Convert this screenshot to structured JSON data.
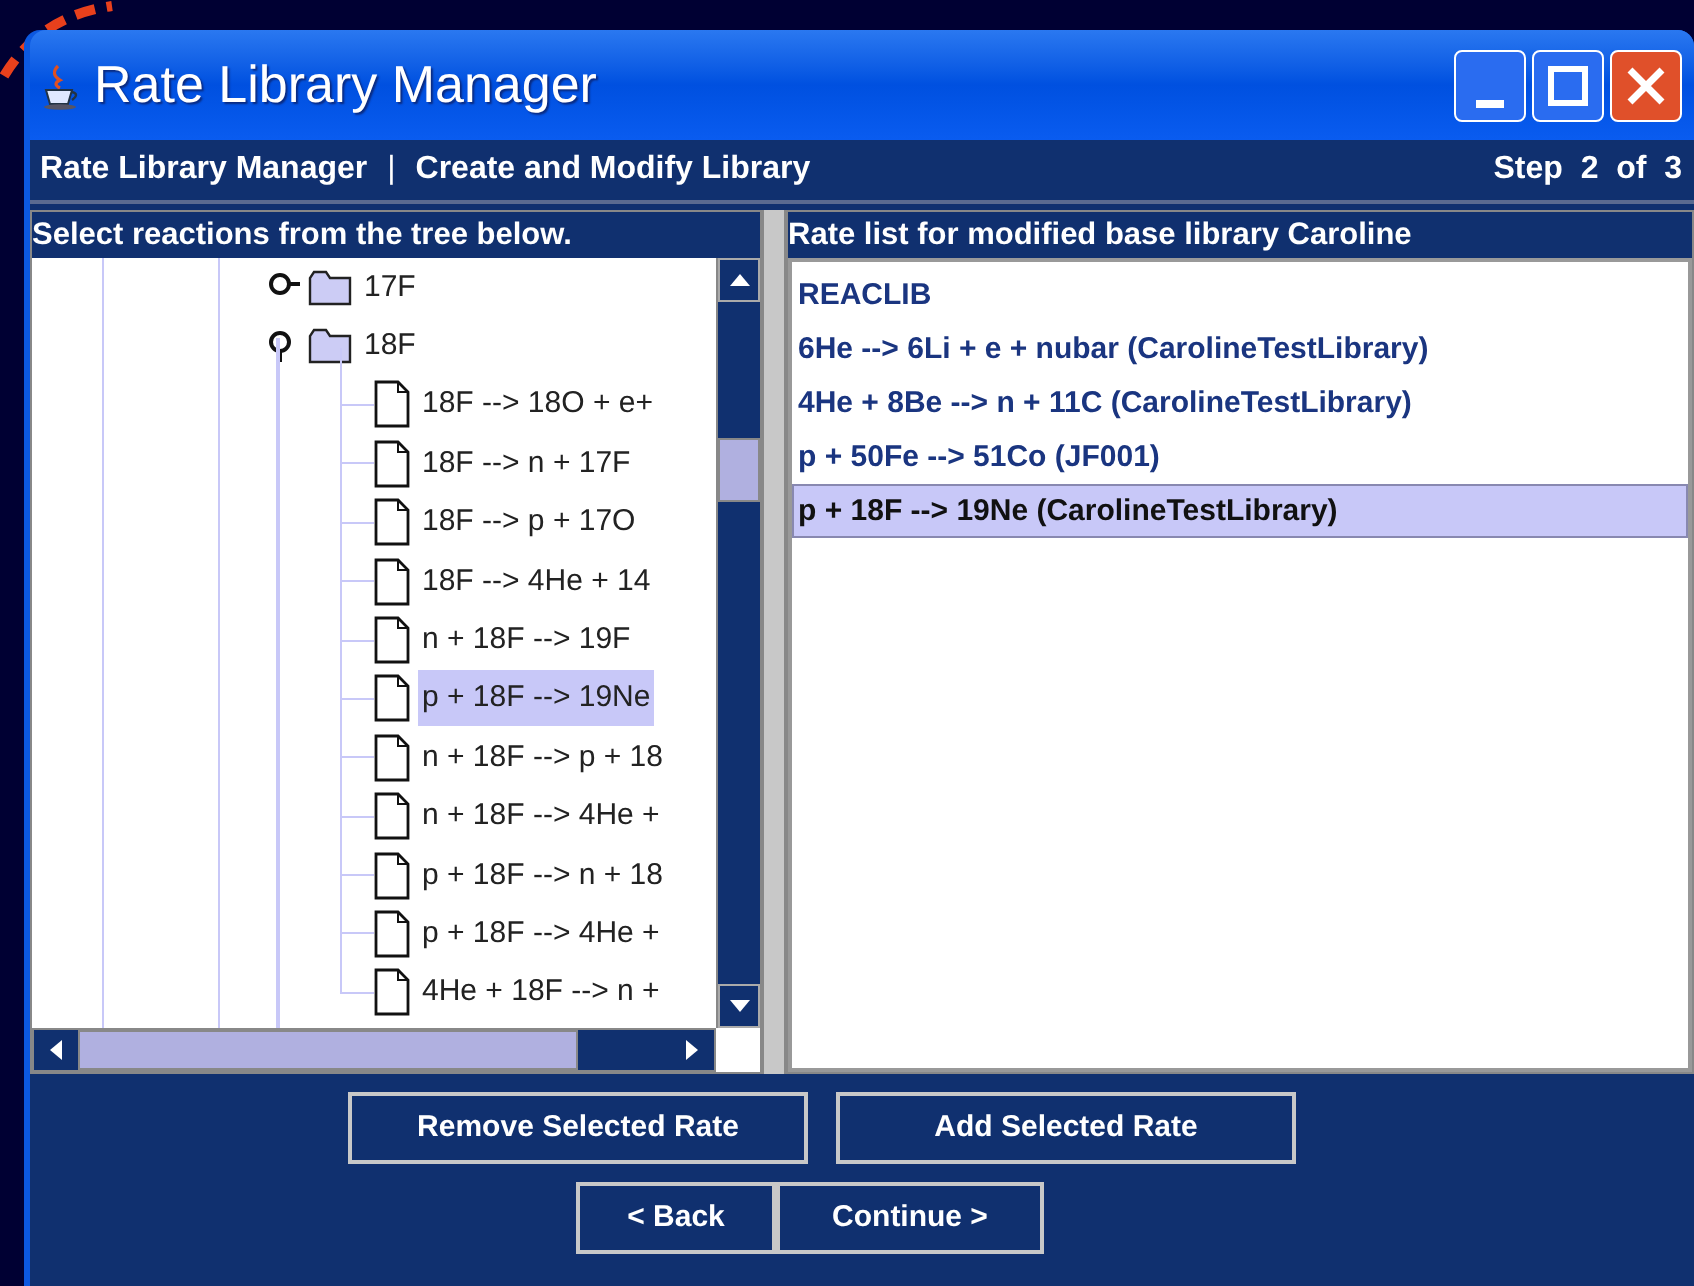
{
  "window": {
    "title": "Rate Library Manager"
  },
  "header": {
    "breadcrumb": [
      "Rate Library Manager",
      "Create and Modify Library"
    ],
    "separator": "|",
    "step": "Step  2  of  3"
  },
  "tree_panel": {
    "title": "Select reactions from the tree below.",
    "nodes": [
      {
        "label": "17F",
        "kind": "folder",
        "expanded": false,
        "selected": false
      },
      {
        "label": "18F",
        "kind": "folder",
        "expanded": true,
        "selected": false,
        "children": [
          {
            "label": "18F --> 18O + e+",
            "kind": "file",
            "selected": false
          },
          {
            "label": "18F --> n + 17F",
            "kind": "file",
            "selected": false
          },
          {
            "label": "18F --> p + 17O",
            "kind": "file",
            "selected": false
          },
          {
            "label": "18F --> 4He + 14",
            "kind": "file",
            "selected": false
          },
          {
            "label": "n + 18F --> 19F",
            "kind": "file",
            "selected": false
          },
          {
            "label": "p + 18F --> 19Ne",
            "kind": "file",
            "selected": true
          },
          {
            "label": "n + 18F --> p + 18",
            "kind": "file",
            "selected": false
          },
          {
            "label": "n + 18F --> 4He +",
            "kind": "file",
            "selected": false
          },
          {
            "label": "p + 18F --> n + 18",
            "kind": "file",
            "selected": false
          },
          {
            "label": "p + 18F --> 4He +",
            "kind": "file",
            "selected": false
          },
          {
            "label": "4He + 18F --> n +",
            "kind": "file",
            "selected": false
          }
        ]
      }
    ]
  },
  "rate_panel": {
    "title": "Rate list for modified base library Caroline",
    "items": [
      {
        "label": "REACLIB",
        "selected": false
      },
      {
        "label": "6He --> 6Li + e + nubar (CarolineTestLibrary)",
        "selected": false
      },
      {
        "label": "4He + 8Be --> n + 11C (CarolineTestLibrary)",
        "selected": false
      },
      {
        "label": "p + 50Fe --> 51Co (JF001)",
        "selected": false
      },
      {
        "label": "p + 18F --> 19Ne (CarolineTestLibrary)",
        "selected": true
      }
    ]
  },
  "action_buttons": [
    {
      "label": "Remove Selected Rate"
    },
    {
      "label": "Add Selected Rate"
    }
  ],
  "nav_buttons": [
    {
      "label": "< Back"
    },
    {
      "label": "Continue >"
    }
  ]
}
